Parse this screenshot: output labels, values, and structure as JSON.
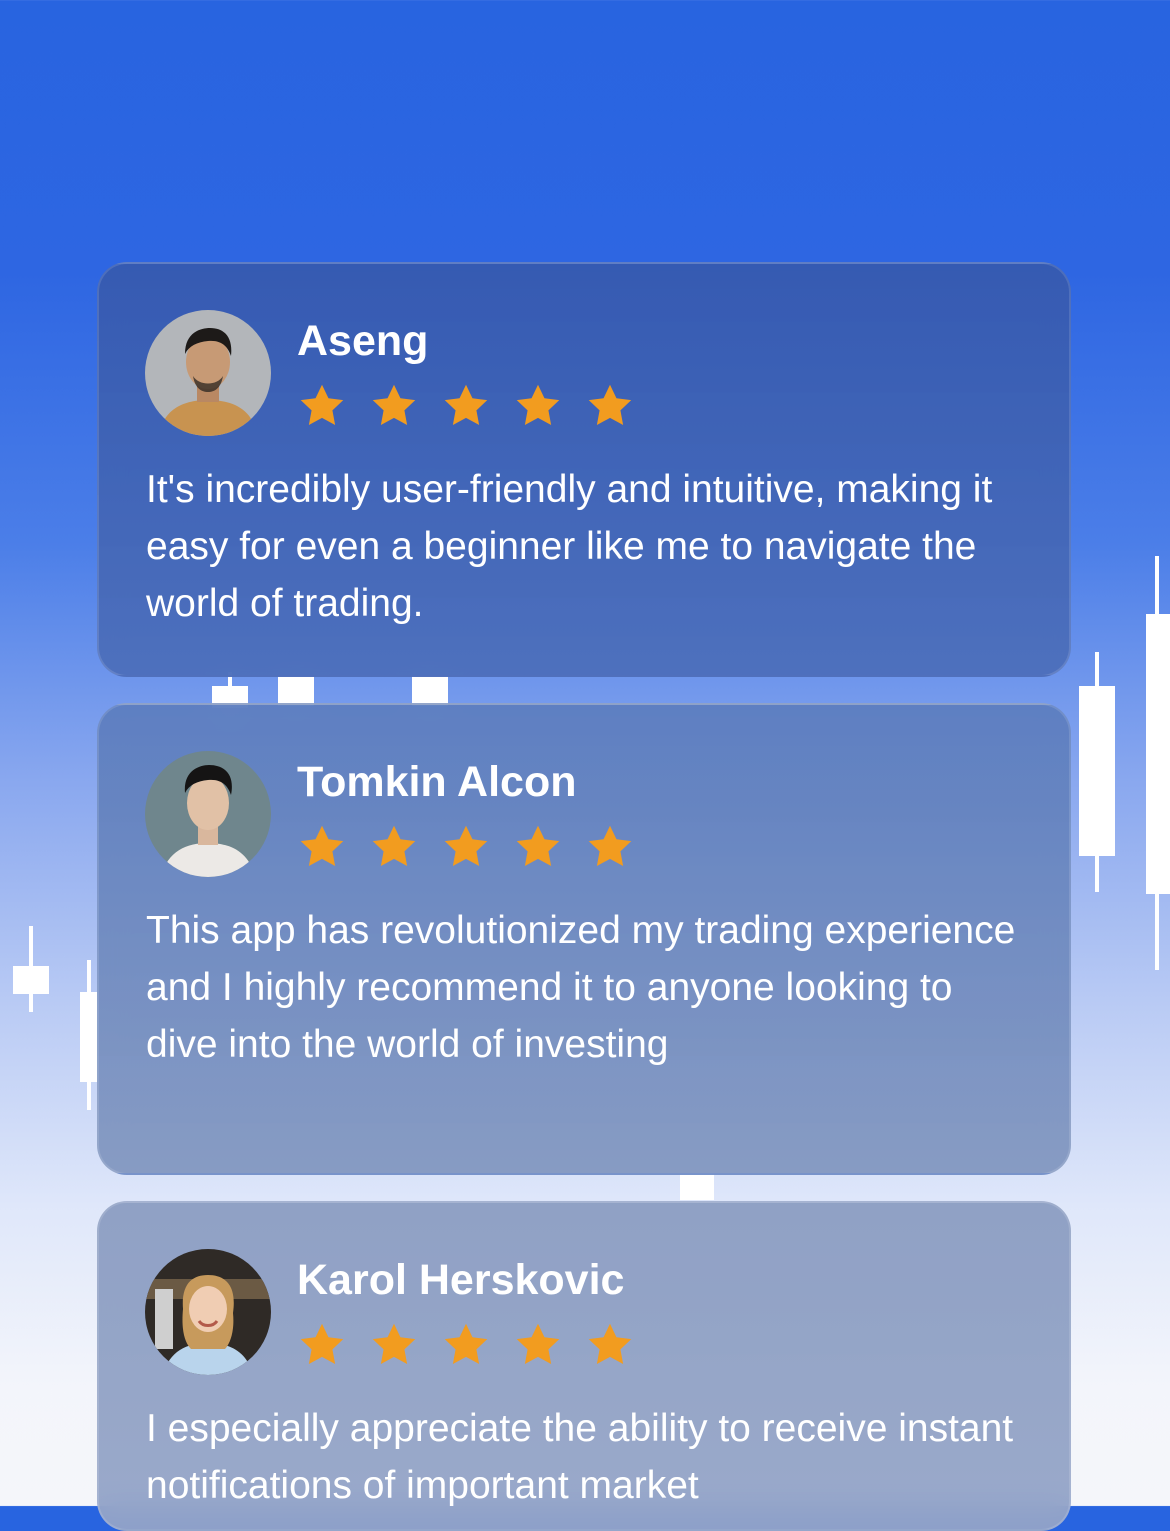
{
  "colors": {
    "background_top": "#2864e0",
    "background_bottom": "#f5f6fa",
    "star": "#f29c1f",
    "text": "#ffffff"
  },
  "reviews": [
    {
      "name": "Aseng",
      "rating": 5,
      "text": "It's incredibly user-friendly and intuitive, making it easy for even a beginner like me to navigate the world of trading."
    },
    {
      "name": "Tomkin Alcon",
      "rating": 5,
      "text": "This app has revolutionized my trading experience and I highly recommend it to anyone looking to dive into the world of investing"
    },
    {
      "name": "Karol Herskovic",
      "rating": 5,
      "text": "I especially appreciate the ability to receive instant notifications of important market"
    }
  ]
}
